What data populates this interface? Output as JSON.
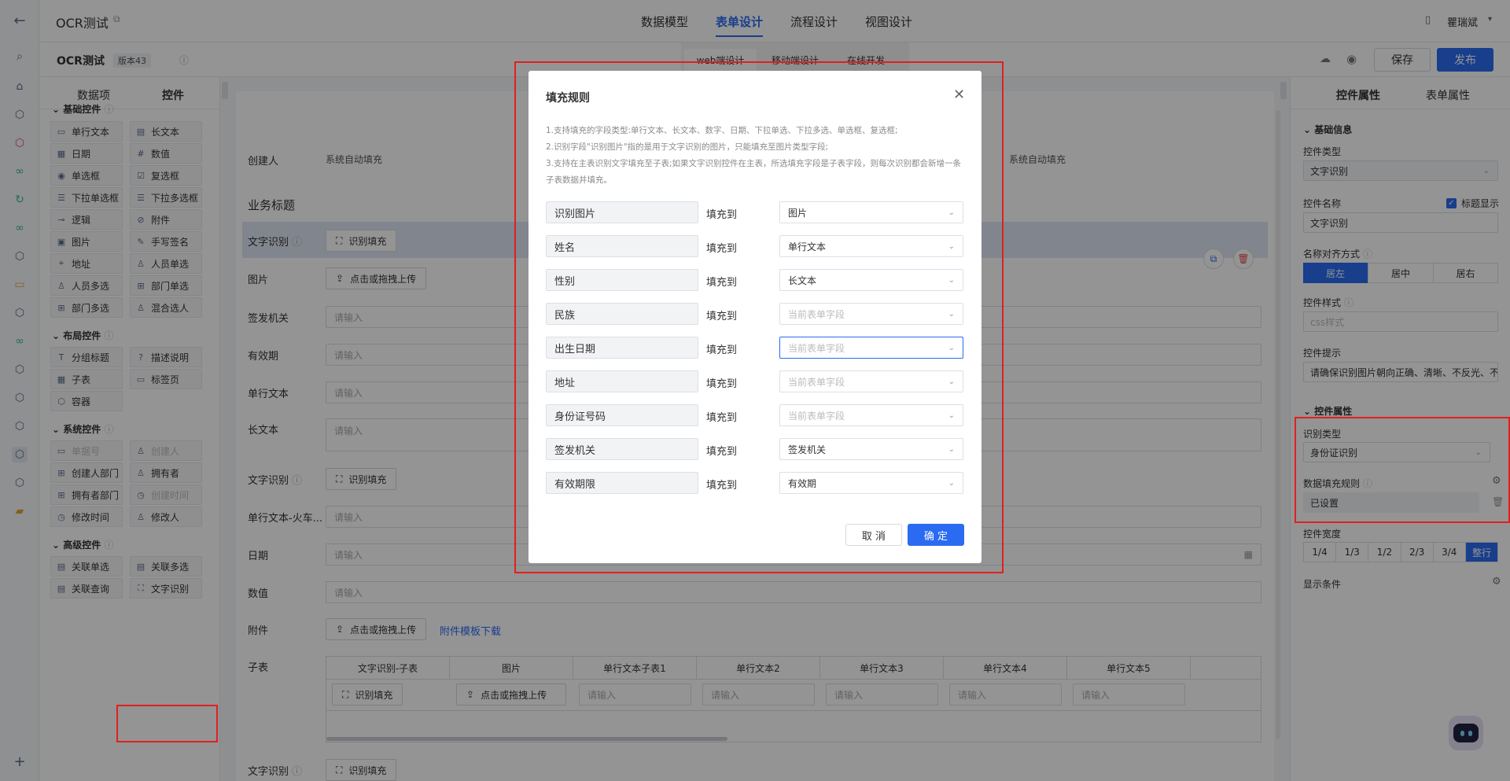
{
  "header": {
    "app_title": "OCR测试",
    "nav_tabs": [
      "数据模型",
      "表单设计",
      "流程设计",
      "视图设计"
    ],
    "user_name": "瞿瑞斌"
  },
  "subbar": {
    "form_name": "OCR测试",
    "version": "版本43",
    "mode_tabs": [
      "web端设计",
      "移动端设计",
      "在线开发"
    ],
    "save_label": "保存",
    "publish_label": "发布"
  },
  "left_panel": {
    "tabs": [
      "数据项",
      "控件"
    ],
    "basic_title": "基础控件",
    "basic_items": [
      "单行文本",
      "长文本",
      "日期",
      "数值",
      "单选框",
      "复选框",
      "下拉单选框",
      "下拉多选框",
      "逻辑",
      "附件",
      "图片",
      "手写签名",
      "地址",
      "人员单选",
      "人员多选",
      "部门单选",
      "部门多选",
      "混合选人"
    ],
    "layout_title": "布局控件",
    "layout_items": [
      "分组标题",
      "描述说明",
      "子表",
      "标签页",
      "容器"
    ],
    "system_title": "系统控件",
    "system_items": [
      "单据号",
      "创建人",
      "创建人部门",
      "拥有者",
      "拥有者部门",
      "创建时间",
      "修改时间",
      "修改人"
    ],
    "advanced_title": "高级控件",
    "advanced_items": [
      "关联单选",
      "关联多选",
      "关联查询",
      "文字识别"
    ]
  },
  "form": {
    "creator_label": "创建人",
    "creator_value": "系统自动填充",
    "creator_value_right": "系统自动填充",
    "section_title": "业务标题",
    "ocr_label": "文字识别",
    "ocr_button": "识别填充",
    "image_label": "图片",
    "upload_button": "点击或拖拽上传",
    "issuer_label": "签发机关",
    "validity_label": "有效期",
    "single_text_label": "单行文本",
    "long_text_label": "长文本",
    "ocr_label2": "文字识别",
    "train_label": "单行文本-火车...",
    "date_label": "日期",
    "number_label": "数值",
    "attach_label": "附件",
    "attach_template_link": "附件模板下载",
    "subtable_label": "子表",
    "subtable_headers": [
      "文字识别-子表",
      "图片",
      "单行文本子表1",
      "单行文本2",
      "单行文本3",
      "单行文本4",
      "单行文本5"
    ],
    "placeholder": "请输入",
    "ocr_label3": "文字识别"
  },
  "right_panel": {
    "tabs": [
      "控件属性",
      "表单属性"
    ],
    "basic_info": "基础信息",
    "type_label": "控件类型",
    "type_value": "文字识别",
    "name_label": "控件名称",
    "show_title_label": "标题显示",
    "name_value": "文字识别",
    "align_label": "名称对齐方式",
    "align_options": [
      "居左",
      "居中",
      "居右"
    ],
    "style_label": "控件样式",
    "style_placeholder": "css样式",
    "hint_label": "控件提示",
    "hint_value": "请确保识别图片朝向正确、清晰、不反光、不",
    "props_title": "控件属性",
    "recog_type_label": "识别类型",
    "recog_type_value": "身份证识别",
    "fill_rule_label": "数据填充规则",
    "fill_rule_value": "已设置",
    "width_label": "控件宽度",
    "width_options": [
      "1/4",
      "1/3",
      "1/2",
      "2/3",
      "3/4",
      "整行"
    ],
    "cond_label": "显示条件"
  },
  "dialog": {
    "title": "填充规则",
    "notes": [
      "1.支持填充的字段类型:单行文本、长文本、数字、日期、下拉单选、下拉多选、单选框、复选框;",
      "2.识别字段\"识别图片\"指的是用于文字识别的图片，只能填充至图片类型字段;",
      "3.支持在主表识别文字填充至子表;如果文字识别控件在主表，所选填充字段是子表字段，则每次识别都会新增一条子表数据并填充。"
    ],
    "fill_to": "填充到",
    "rows": [
      {
        "field": "识别图片",
        "target": "图片",
        "placeholder": false
      },
      {
        "field": "姓名",
        "target": "单行文本",
        "placeholder": false
      },
      {
        "field": "性别",
        "target": "长文本",
        "placeholder": false
      },
      {
        "field": "民族",
        "target": "当前表单字段",
        "placeholder": true
      },
      {
        "field": "出生日期",
        "target": "当前表单字段",
        "placeholder": true
      },
      {
        "field": "地址",
        "target": "当前表单字段",
        "placeholder": true
      },
      {
        "field": "身份证号码",
        "target": "当前表单字段",
        "placeholder": true
      },
      {
        "field": "签发机关",
        "target": "签发机关",
        "placeholder": false
      },
      {
        "field": "有效期限",
        "target": "有效期",
        "placeholder": false
      }
    ],
    "cancel_label": "取 消",
    "confirm_label": "确 定"
  },
  "colors": {
    "primary": "#2a6bf2",
    "highlight": "#e02020"
  }
}
